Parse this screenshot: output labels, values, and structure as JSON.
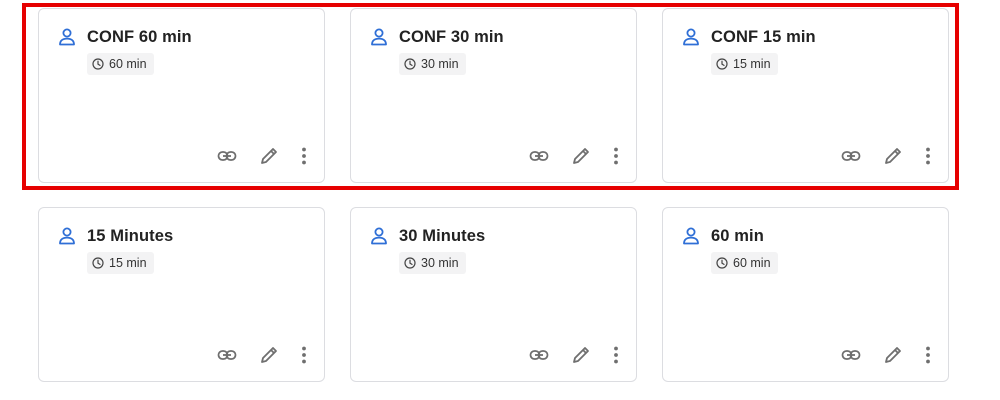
{
  "colors": {
    "accent": "#2f6fd6",
    "icon_gray": "#6f6f6f",
    "highlight": "#e60000",
    "border": "#dcdde1",
    "chip_bg": "#f3f3f4"
  },
  "cards": [
    {
      "title": "CONF 60 min",
      "duration": "60 min"
    },
    {
      "title": "CONF 30 min",
      "duration": "30 min"
    },
    {
      "title": "CONF 15 min",
      "duration": "15 min"
    },
    {
      "title": "15 Minutes",
      "duration": "15 min"
    },
    {
      "title": "30 Minutes",
      "duration": "30 min"
    },
    {
      "title": "60 min",
      "duration": "60 min"
    }
  ],
  "icons": {
    "type": "user-icon",
    "duration": "clock-icon",
    "actions": [
      "link-icon",
      "edit-icon",
      "more-vertical-icon"
    ]
  }
}
